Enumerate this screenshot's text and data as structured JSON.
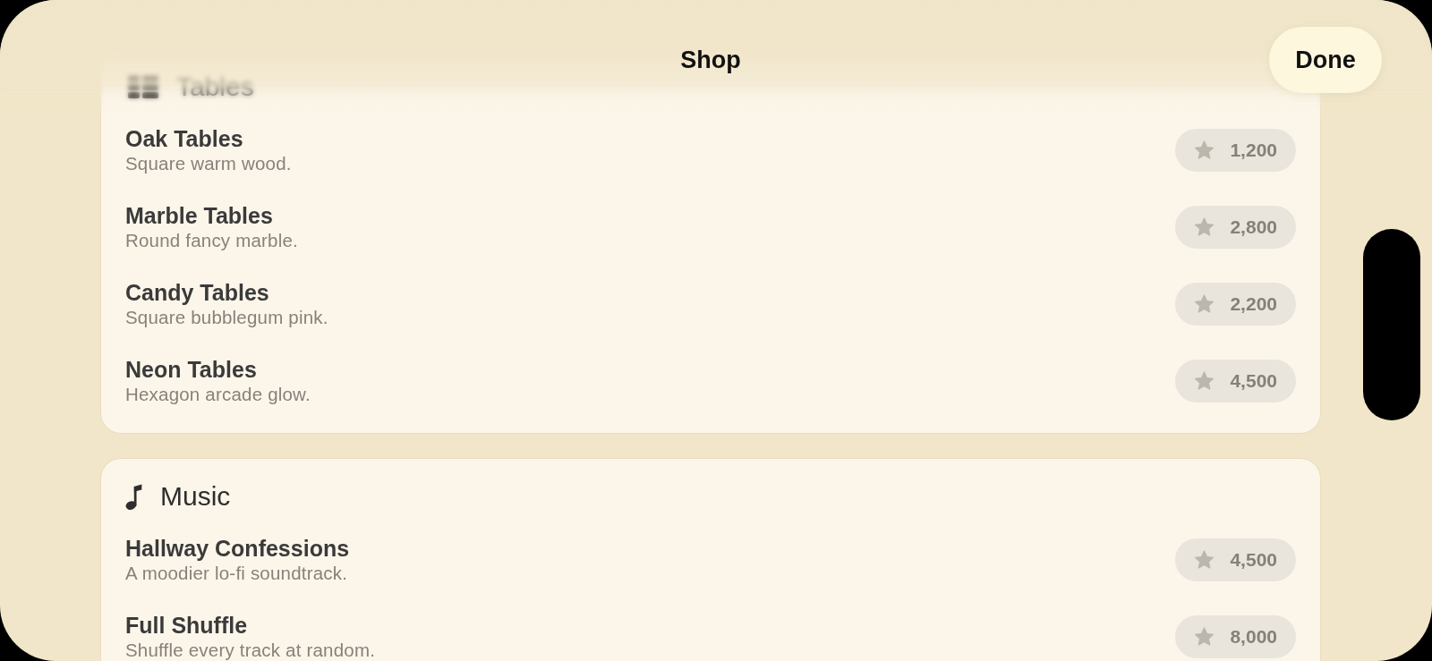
{
  "navigation": {
    "title": "Shop",
    "done_button": "Done"
  },
  "sections": [
    {
      "kind": "tables",
      "title": "Tables",
      "items": [
        {
          "name": "Oak Tables",
          "description": "Square warm wood.",
          "price": "1,200",
          "disabled": true
        },
        {
          "name": "Marble Tables",
          "description": "Round fancy marble.",
          "price": "2,800",
          "disabled": true
        },
        {
          "name": "Candy Tables",
          "description": "Square bubblegum pink.",
          "price": "2,200",
          "disabled": true
        },
        {
          "name": "Neon Tables",
          "description": "Hexagon arcade glow.",
          "price": "4,500",
          "disabled": true
        }
      ]
    },
    {
      "kind": "music",
      "title": "Music",
      "items": [
        {
          "name": "Hallway Confessions",
          "description": "A moodier lo-fi soundtrack.",
          "price": "4,500",
          "disabled": true
        },
        {
          "name": "Full Shuffle",
          "description": "Shuffle every track at random.",
          "price": "8,000",
          "disabled": true
        }
      ]
    }
  ]
}
